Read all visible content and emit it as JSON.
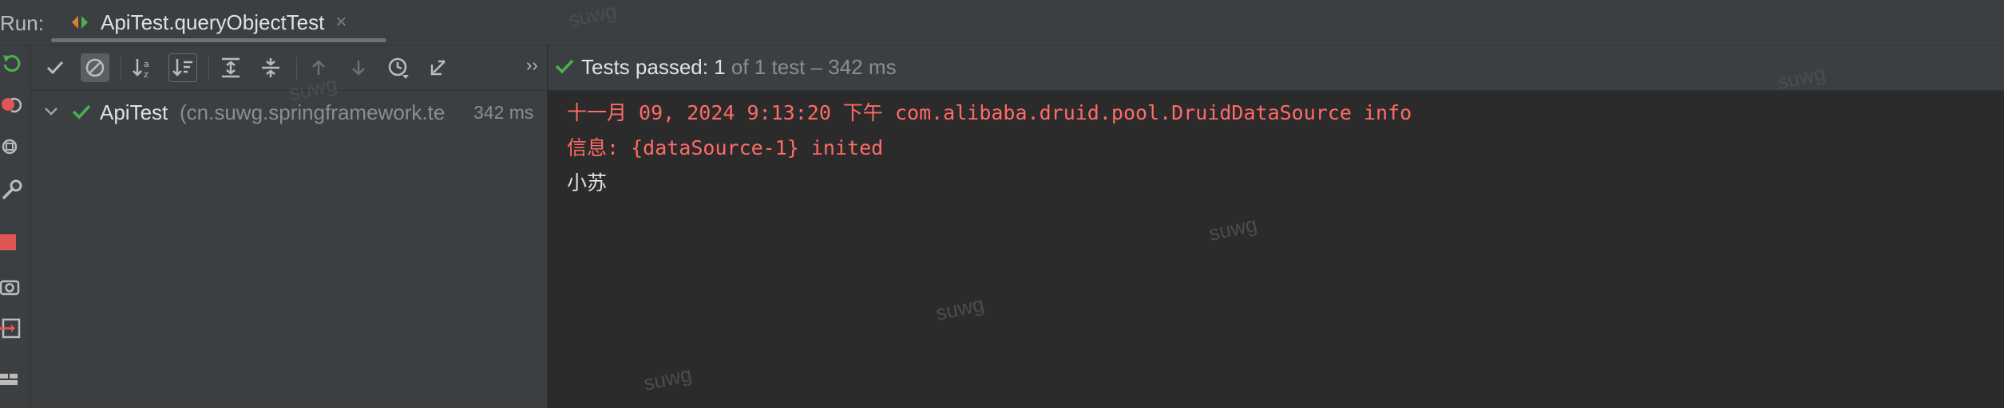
{
  "run": {
    "label": "Run:",
    "tab_title": "ApiTest.queryObjectTest",
    "tab_close": "×"
  },
  "toolbar": {
    "chevron": "››"
  },
  "tree": {
    "row": {
      "name": "ApiTest",
      "package": "(cn.suwg.springframework.te",
      "time": "342 ms"
    }
  },
  "status": {
    "prefix": "Tests passed: ",
    "passed": "1",
    "suffix": " of 1 test – 342 ms"
  },
  "console": {
    "lines": [
      "十一月 09, 2024 9:13:20 下午 com.alibaba.druid.pool.DruidDataSource info",
      "信息: {dataSource-1} inited",
      "小苏"
    ]
  },
  "watermark": "suwg",
  "colors": {
    "success": "#4caf50",
    "error_text": "#ff6b68",
    "stop": "#e05555"
  }
}
